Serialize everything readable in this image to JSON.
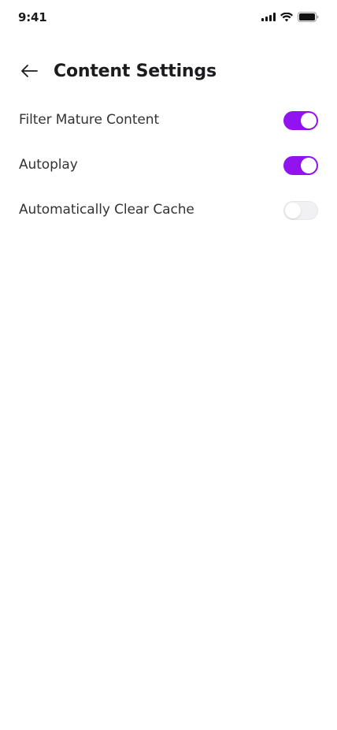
{
  "status_bar": {
    "time": "9:41",
    "icons": [
      "signal-icon",
      "wifi-icon",
      "battery-icon"
    ]
  },
  "header": {
    "back_icon": "arrow-left-icon",
    "title": "Content Settings"
  },
  "settings": [
    {
      "label": "Filter Mature Content",
      "enabled": true
    },
    {
      "label": "Autoplay",
      "enabled": true
    },
    {
      "label": "Automatically Clear Cache",
      "enabled": false
    }
  ],
  "colors": {
    "accent": "#9113f0",
    "toggle_off": "#f1f1f3",
    "text_primary": "#1c1c1e",
    "text_secondary": "#333333"
  }
}
